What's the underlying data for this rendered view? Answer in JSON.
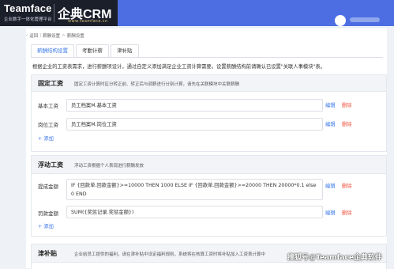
{
  "header": {
    "logo_name": "Teamface",
    "logo_tagline": "企业数字一体化管理平台",
    "brand": "企典CRM",
    "brand_url": "www.teamface.cn",
    "accent_color": "#4c6ee2"
  },
  "breadcrumb": [
    "返回",
    "薪酬设置",
    "薪酬设置"
  ],
  "tabs": [
    {
      "label": "薪酬结构设置",
      "active": true
    },
    {
      "label": "考勤计薪",
      "active": false
    },
    {
      "label": "津补贴",
      "active": false
    }
  ],
  "intro": "根据企业的工资表需求，进行薪酬项设计，通过自定义添加满足企业工资计算需要。设置薪酬结构前请确认已设置\"关联人事模块\"表。",
  "sections": {
    "fixed": {
      "title": "固定工资",
      "desc": "固定工资计算时区分转正前、转正后与调薪进行分别计算，请先在关联模块中关联薪酬",
      "rows": [
        {
          "label": "基本工资",
          "value": "员工档案M.基本工资"
        },
        {
          "label": "岗位工资",
          "value": "员工档案M.岗位工资"
        }
      ],
      "add_label": "+ 添加"
    },
    "floating": {
      "title": "浮动工资",
      "desc": "浮动工资根据个人表现进行薪酬发放",
      "rows": [
        {
          "label": "提成金额",
          "value": "IF {回款单.回款金额}>=10000 THEN 1000 ELSE IF {回款单.回款金额}>=20000 THEN 20000*0.1 else 0 END"
        },
        {
          "label": "罚款金额",
          "value": "SUM({奖惩记录.奖惩金额})"
        }
      ],
      "add_label": "+ 添加"
    },
    "allowance": {
      "title": "津补贴",
      "desc": "企业给员工提供的福利，请在津补贴中设定福利规则，系统将在核算工资时将补贴加入工资表计算中"
    }
  },
  "actions": {
    "edit": "编辑",
    "delete": "删除"
  },
  "watermark": "搜狐号@Teamface企典软件"
}
